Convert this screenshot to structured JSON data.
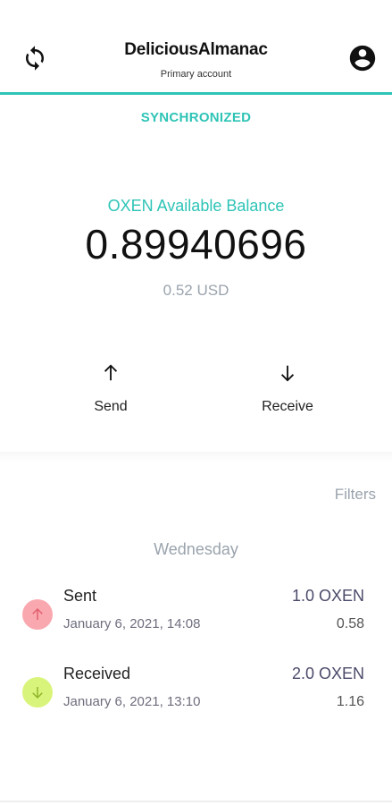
{
  "header": {
    "account_name": "DeliciousAlmanac",
    "account_subtitle": "Primary account",
    "refresh_icon": "refresh-icon",
    "profile_icon": "account-circle-icon",
    "accent_color": "#2ec4b6"
  },
  "status": {
    "sync_text": "SYNCHRONIZED"
  },
  "balance": {
    "label": "OXEN Available Balance",
    "value": "0.89940696",
    "fiat": "0.52 USD"
  },
  "actions": {
    "send_label": "Send",
    "receive_label": "Receive"
  },
  "transactions": {
    "filters_label": "Filters",
    "day_label": "Wednesday",
    "items": [
      {
        "type": "Sent",
        "date": "January 6, 2021, 14:08",
        "amount": "1.0 OXEN",
        "fiat": "0.58",
        "icon": "arrow-up-icon",
        "color": "#f9a8b0"
      },
      {
        "type": "Received",
        "date": "January 6, 2021, 13:10",
        "amount": "2.0 OXEN",
        "fiat": "1.16",
        "icon": "arrow-down-icon",
        "color": "#d9f47a"
      }
    ]
  }
}
